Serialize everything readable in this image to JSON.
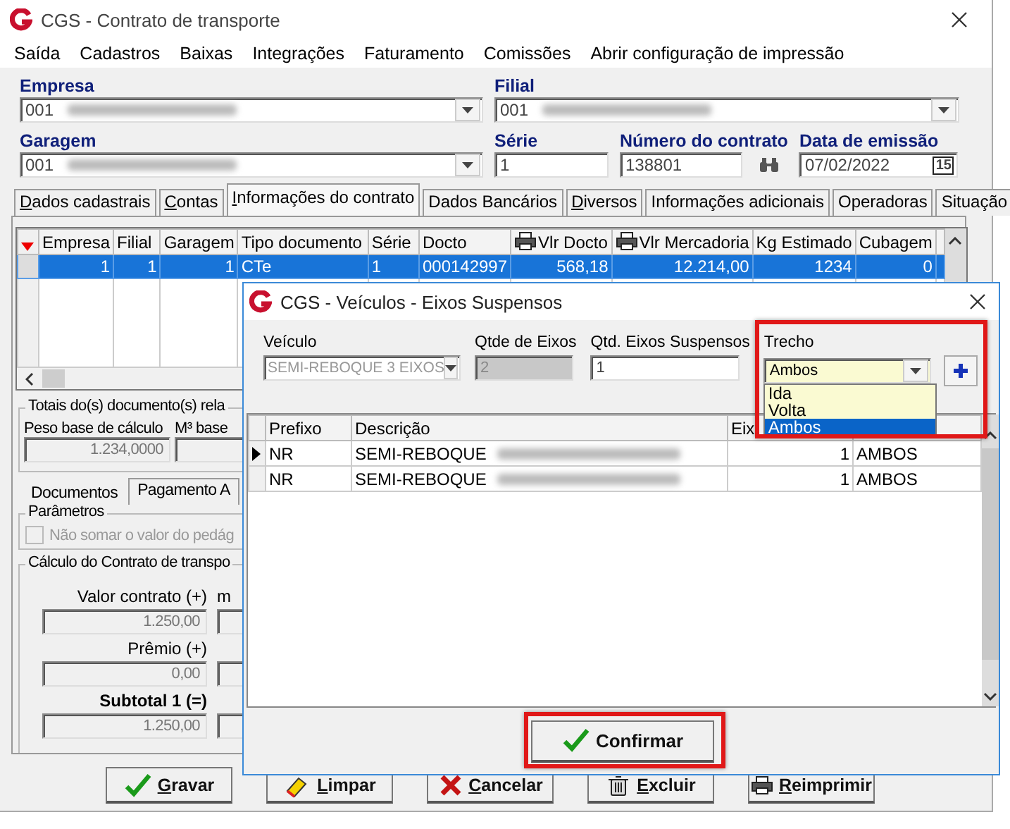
{
  "window": {
    "title": "CGS - Contrato de transporte"
  },
  "menu": [
    "Saída",
    "Cadastros",
    "Baixas",
    "Integrações",
    "Faturamento",
    "Comissões",
    "Abrir configuração de impressão"
  ],
  "header_rows": [
    [
      {
        "label": "Empresa",
        "value": "001",
        "kind": "combo",
        "blurred": true
      },
      {
        "label": "Filial",
        "value": "001",
        "kind": "combo",
        "blurred": true
      }
    ],
    [
      {
        "label": "Garagem",
        "value": "001",
        "kind": "combo",
        "blurred": true
      },
      {
        "label": "Série",
        "value": "1",
        "kind": "text",
        "blurred": false
      },
      {
        "label": "Número do contrato",
        "value": "138801",
        "kind": "lookup",
        "blurred": false
      },
      {
        "label": "Data de emissão",
        "value": "07/02/2022",
        "kind": "date",
        "blurred": false,
        "calendar_day": "15"
      }
    ]
  ],
  "tabs": [
    {
      "label": "Dados cadastrais",
      "selected": false,
      "underlined": true
    },
    {
      "label": "Contas",
      "selected": false,
      "underlined": true
    },
    {
      "label": "Informações do contrato",
      "selected": true,
      "underlined": true
    },
    {
      "label": "Dados Bancários",
      "selected": false,
      "underlined": false
    },
    {
      "label": "Diversos",
      "selected": false,
      "underlined": true
    },
    {
      "label": "Informações adicionais",
      "selected": false,
      "underlined": false
    },
    {
      "label": "Operadoras",
      "selected": false,
      "underlined": false
    },
    {
      "label": "Situação",
      "selected": false,
      "underlined": false
    }
  ],
  "documents_table": {
    "columns": [
      {
        "label": "Empresa",
        "kind": "plain"
      },
      {
        "label": "Filial",
        "kind": "plain"
      },
      {
        "label": "Garagem",
        "kind": "plain"
      },
      {
        "label": "Tipo documento",
        "kind": "plain"
      },
      {
        "label": "Série",
        "kind": "plain"
      },
      {
        "label": "Docto",
        "kind": "plain"
      },
      {
        "label": "Vlr Docto",
        "kind": "printable"
      },
      {
        "label": "Vlr Mercadoria",
        "kind": "printable"
      },
      {
        "label": "Kg Estimado",
        "kind": "plain"
      },
      {
        "label": "Cubagem",
        "kind": "plain"
      }
    ],
    "rows": [
      {
        "selected": true,
        "cells": [
          "1",
          "1",
          "1",
          "CTe",
          "1",
          "000142997",
          "568,18",
          "12.214,00",
          "1234",
          "0"
        ]
      }
    ]
  },
  "totals": {
    "legend": "Totais do(s) documento(s) rela",
    "fields": [
      {
        "label": "Peso base de cálculo",
        "value": "1.234,0000"
      },
      {
        "label": "M³ base"
      }
    ]
  },
  "subtabs": [
    {
      "label": "Documentos",
      "selected": false
    },
    {
      "label": "Pagamento A",
      "selected": true
    }
  ],
  "parameters": {
    "legend": "Parâmetros",
    "checkboxes": [
      {
        "label": "Não somar o valor do pedág",
        "checked": false,
        "disabled": true
      }
    ]
  },
  "calculation": {
    "legend": "Cálculo do Contrato de transpo",
    "fields": [
      {
        "label": "Valor contrato (+)",
        "value": "1.250,00",
        "bold": false
      },
      {
        "label": "Prêmio (+)",
        "value": "0,00",
        "bold": false
      },
      {
        "label": "Subtotal 1 (=)",
        "value": "1.250,00",
        "bold": true
      }
    ],
    "column_2_label": "m"
  },
  "buttons": [
    {
      "label": "Gravar",
      "kind": "save"
    },
    {
      "label": "Limpar",
      "kind": "clear"
    },
    {
      "label": "Cancelar",
      "kind": "cancel"
    },
    {
      "label": "Excluir",
      "kind": "delete"
    },
    {
      "label": "Reimprimir",
      "kind": "reprint"
    }
  ],
  "dialog": {
    "title": "CGS - Veículos - Eixos Suspensos",
    "fields": [
      {
        "label": "Veículo",
        "value": "SEMI-REBOQUE 3 EIXOS",
        "kind": "combo",
        "disabled": true,
        "expanded": false
      },
      {
        "label": "Qtde de Eixos",
        "value": "2",
        "kind": "text",
        "disabled": true,
        "expanded": false
      },
      {
        "label": "Qtd. Eixos Suspensos",
        "value": "1",
        "kind": "text",
        "disabled": false,
        "expanded": false
      },
      {
        "label": "Trecho",
        "value": "Ambos",
        "kind": "combo",
        "disabled": false,
        "expanded": true,
        "options": [
          {
            "label": "Ida",
            "selected": false
          },
          {
            "label": "Volta",
            "selected": false
          },
          {
            "label": "Ambos",
            "selected": true
          }
        ]
      }
    ],
    "table": {
      "columns": [
        "Prefixo",
        "Descrição",
        "Eix"
      ],
      "rows": [
        {
          "current": true,
          "cells": [
            "NR",
            "SEMI-REBOQUE",
            "1",
            "AMBOS"
          ]
        },
        {
          "current": false,
          "cells": [
            "NR",
            "SEMI-REBOQUE",
            "1",
            "AMBOS"
          ]
        }
      ]
    },
    "confirm_button": "Confirmar"
  }
}
